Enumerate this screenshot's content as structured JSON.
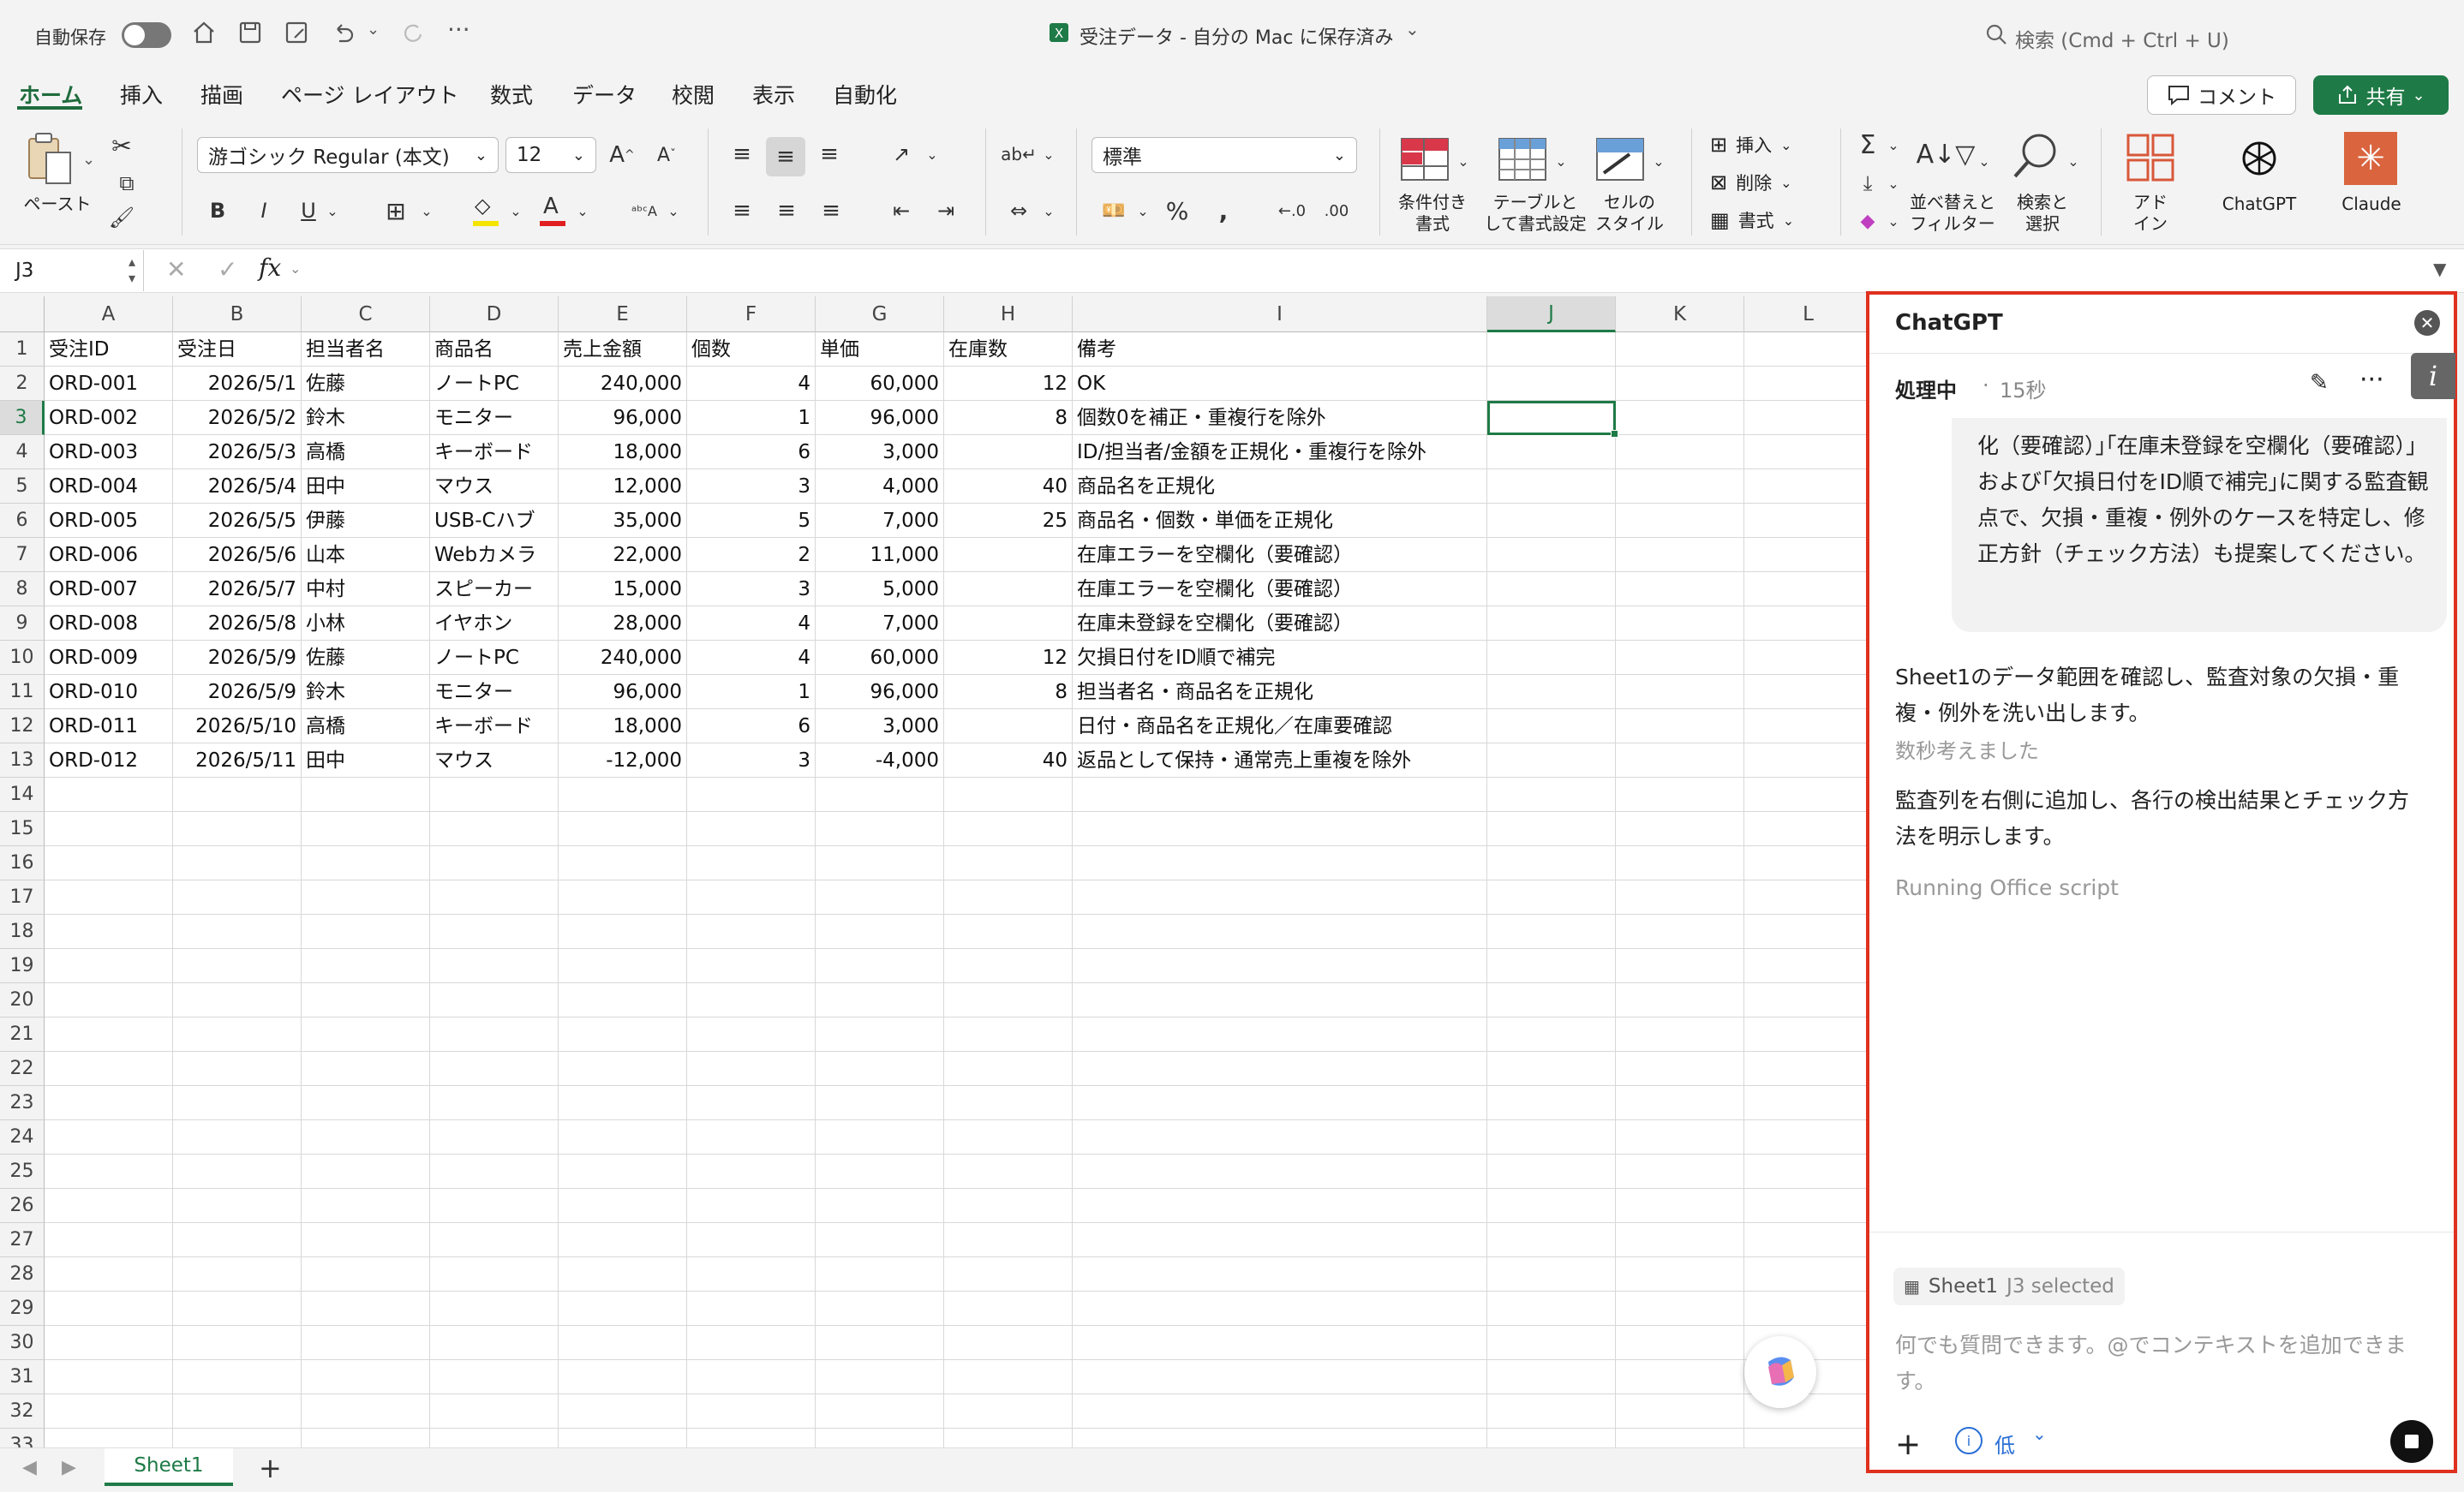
{
  "titlebar": {
    "autosave_label": "自動保存",
    "doc_title": "受注データ - 自分の Mac に保存済み",
    "search_placeholder": "検索 (Cmd + Ctrl + U)"
  },
  "tabs": [
    "ホーム",
    "挿入",
    "描画",
    "ページ レイアウト",
    "数式",
    "データ",
    "校閲",
    "表示",
    "自動化"
  ],
  "comment_label": "コメント",
  "share_label": "共有",
  "ribbon": {
    "paste_label": "ペースト",
    "font_name": "游ゴシック Regular (本文)",
    "font_size": "12",
    "number_format": "標準",
    "conditional_format": "条件付き\n書式",
    "table_format": "テーブルと\nして書式設定",
    "cell_style": "セルの\nスタイル",
    "insert": "挿入",
    "delete": "削除",
    "format": "書式",
    "sort_filter": "並べ替えと\nフィルター",
    "find_select": "検索と\n選択",
    "addin": "アド\nイン",
    "chatgpt": "ChatGPT",
    "claude": "Claude"
  },
  "formula_bar": {
    "cell_ref": "J3",
    "fx": "fx"
  },
  "columns": [
    "A",
    "B",
    "C",
    "D",
    "E",
    "F",
    "G",
    "H",
    "I",
    "J",
    "K",
    "L"
  ],
  "rows": [
    [
      "受注ID",
      "受注日",
      "担当者名",
      "商品名",
      "売上金額",
      "個数",
      "単価",
      "在庫数",
      "備考"
    ],
    [
      "ORD-001",
      "2026/5/1",
      "佐藤",
      "ノートPC",
      "240,000",
      "4",
      "60,000",
      "12",
      "OK"
    ],
    [
      "ORD-002",
      "2026/5/2",
      "鈴木",
      "モニター",
      "96,000",
      "1",
      "96,000",
      "8",
      "個数0を補正・重複行を除外"
    ],
    [
      "ORD-003",
      "2026/5/3",
      "高橋",
      "キーボード",
      "18,000",
      "6",
      "3,000",
      "",
      "ID/担当者/金額を正規化・重複行を除外"
    ],
    [
      "ORD-004",
      "2026/5/4",
      "田中",
      "マウス",
      "12,000",
      "3",
      "4,000",
      "40",
      "商品名を正規化"
    ],
    [
      "ORD-005",
      "2026/5/5",
      "伊藤",
      "USB-Cハブ",
      "35,000",
      "5",
      "7,000",
      "25",
      "商品名・個数・単価を正規化"
    ],
    [
      "ORD-006",
      "2026/5/6",
      "山本",
      "Webカメラ",
      "22,000",
      "2",
      "11,000",
      "",
      "在庫エラーを空欄化（要確認）"
    ],
    [
      "ORD-007",
      "2026/5/7",
      "中村",
      "スピーカー",
      "15,000",
      "3",
      "5,000",
      "",
      "在庫エラーを空欄化（要確認）"
    ],
    [
      "ORD-008",
      "2026/5/8",
      "小林",
      "イヤホン",
      "28,000",
      "4",
      "7,000",
      "",
      "在庫未登録を空欄化（要確認）"
    ],
    [
      "ORD-009",
      "2026/5/9",
      "佐藤",
      "ノートPC",
      "240,000",
      "4",
      "60,000",
      "12",
      "欠損日付をID順で補完"
    ],
    [
      "ORD-010",
      "2026/5/9",
      "鈴木",
      "モニター",
      "96,000",
      "1",
      "96,000",
      "8",
      "担当者名・商品名を正規化"
    ],
    [
      "ORD-011",
      "2026/5/10",
      "高橋",
      "キーボード",
      "18,000",
      "6",
      "3,000",
      "",
      "日付・商品名を正規化／在庫要確認"
    ],
    [
      "ORD-012",
      "2026/5/11",
      "田中",
      "マウス",
      "-12,000",
      "3",
      "-4,000",
      "40",
      "返品として保持・通常売上重複を除外"
    ]
  ],
  "row_numbers": [
    "1",
    "2",
    "3",
    "4",
    "5",
    "6",
    "7",
    "8",
    "9",
    "10",
    "11",
    "12",
    "13",
    "14",
    "15",
    "16",
    "17",
    "18",
    "19",
    "20",
    "21",
    "22",
    "23",
    "24",
    "25",
    "26",
    "27",
    "28",
    "29",
    "30",
    "31",
    "32",
    "33"
  ],
  "sheet_tab": "Sheet1",
  "panel": {
    "title": "ChatGPT",
    "status": "処理中",
    "elapsed": "15秒",
    "user_message": "化（要確認）｣｢在庫未登録を空欄化（要確認）｣および｢欠損日付をID順で補完｣に関する監査観点で、欠損・重複・例外のケースを特定し、修正方針（チェック方法）も提案してください。",
    "reply1": "Sheet1のデータ範囲を確認し、監査対象の欠損・重複・例外を洗い出します。",
    "thinking": "数秒考えました",
    "reply2": "監査列を右側に追加し、各行の検出結果とチェック方法を明示します。",
    "running": "Running Office script",
    "context_chip_sheet": "Sheet1",
    "context_chip_sel": "J3 selected",
    "input_placeholder": "何でも質問できます。@でコンテキストを追加できます。",
    "effort_label": "低"
  }
}
